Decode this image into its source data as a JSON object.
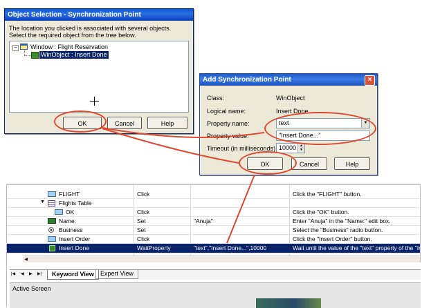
{
  "obj_dialog": {
    "title": "Object Selection - Synchronization Point",
    "desc1": "The location you clicked is associated with several objects.",
    "desc2": "Select the required object from the tree below.",
    "tree": [
      {
        "label": "Window : Flight Reservation"
      },
      {
        "label": "WinObject : Insert Done"
      }
    ],
    "ok": "OK",
    "cancel": "Cancel",
    "help": "Help"
  },
  "sync_dialog": {
    "title": "Add Synchronization Point",
    "class_label": "Class:",
    "class_value": "WinObject",
    "logical_label": "Logical name:",
    "logical_value": "Insert Done",
    "propname_label": "Property name:",
    "propname_value": "text",
    "propvalue_label": "Property value:",
    "propvalue_value": "\"Insert Done...\"",
    "timeout_label": "Timeout (in milliseconds):",
    "timeout_value": "10000",
    "ok": "OK",
    "cancel": "Cancel",
    "help": "Help"
  },
  "grid": {
    "rows": [
      {
        "item": "FLIGHT",
        "op": "Click",
        "val": "",
        "doc": "Click the \"FLIGHT\" button.",
        "icon": "button-icon"
      },
      {
        "item": "Flights Table",
        "op": "",
        "val": "",
        "doc": "",
        "icon": "table-icon"
      },
      {
        "item": "OK",
        "op": "Click",
        "val": "",
        "doc": "Click the \"OK\" button.",
        "icon": "button-icon"
      },
      {
        "item": "Name:",
        "op": "Set",
        "val": "\"Anuja\"",
        "doc": "Enter \"Anuja\" in the \"Name:\" edit box.",
        "icon": "edit-icon"
      },
      {
        "item": "Business",
        "op": "Set",
        "val": "",
        "doc": "Select the \"Business\" radio button.",
        "icon": "radio-icon"
      },
      {
        "item": "Insert Order",
        "op": "Click",
        "val": "",
        "doc": "Click the \"Insert Order\" button.",
        "icon": "button-icon"
      },
      {
        "item": "Insert Done",
        "op": "WaitProperty",
        "val": "\"text\",\"Insert Done...\",10000",
        "doc": "Wait until the value of the \"text\" property of the \"Inse",
        "icon": "winobject-icon"
      }
    ]
  },
  "tabs": {
    "keyword": "Keyword View",
    "expert": "Expert View"
  },
  "active_screen": "Active Screen",
  "colors": {
    "annotation": "#e0462e",
    "selection": "#0a246a",
    "titlebar": "#0a58d8"
  }
}
